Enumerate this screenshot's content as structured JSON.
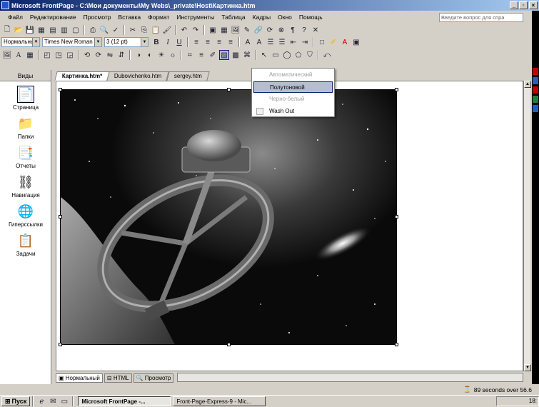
{
  "window": {
    "title": "Microsoft FrontPage - C:\\Мои документы\\My Webs\\_private\\Host\\Картинка.htm",
    "minimize": "_",
    "restore": "▫",
    "close": "×"
  },
  "menu": {
    "items": [
      "Файл",
      "Редактирование",
      "Просмотр",
      "Вставка",
      "Формат",
      "Инструменты",
      "Таблица",
      "Кадры",
      "Окно",
      "Помощь"
    ],
    "help_placeholder": "Введите вопрос для спра"
  },
  "formatting": {
    "style": "Нормальный",
    "font": "Times New Roman",
    "size": "3 (12 pt)"
  },
  "views": {
    "header": "Виды",
    "items": [
      {
        "label": "Страница",
        "icon": "page-icon"
      },
      {
        "label": "Папки",
        "icon": "folder-icon"
      },
      {
        "label": "Отчеты",
        "icon": "reports-icon"
      },
      {
        "label": "Навигация",
        "icon": "navigation-icon"
      },
      {
        "label": "Гиперссылки",
        "icon": "hyperlinks-icon"
      },
      {
        "label": "Задачи",
        "icon": "tasks-icon"
      }
    ]
  },
  "tabs": [
    "Картинка.htm*",
    "Dubovichenko.htm",
    "sergey.htm"
  ],
  "color_menu": {
    "items": [
      {
        "label": "Автоматический",
        "state": "disabled"
      },
      {
        "label": "Полутоновой",
        "state": "highlighted"
      },
      {
        "label": "Черно-белый",
        "state": "disabled"
      },
      {
        "label": "Wash Out",
        "state": "normal"
      }
    ]
  },
  "view_tabs": [
    "Нормальный",
    "HTML",
    "Просмотр"
  ],
  "status": {
    "download": "89 seconds over 56.6"
  },
  "taskbar": {
    "start": "Пуск",
    "tasks": [
      "Microsoft FrontPage -...",
      "Front-Page-Express-9 - Mic..."
    ],
    "clock": "18:"
  },
  "colors": {
    "titlebar": "#0a246a",
    "highlight": "#b6bdd2",
    "chrome": "#d4d0c8"
  }
}
